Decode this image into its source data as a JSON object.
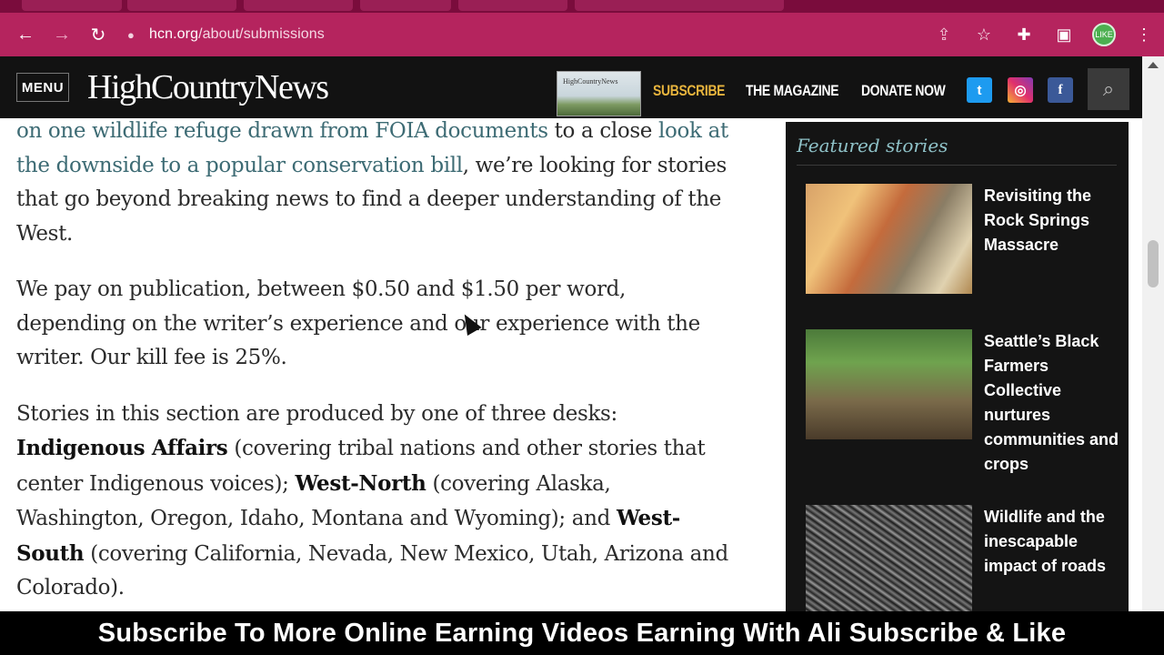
{
  "browser": {
    "url_host": "hcn.org",
    "url_path": "/about/submissions",
    "profile_label": "LIKE",
    "colors": {
      "frame": "#b5245e",
      "tabstrip": "#7a0c3c"
    }
  },
  "site": {
    "menu_label": "MENU",
    "logo_text": "HighCountryNews",
    "magazine_thumb_label": "HighCountryNews",
    "nav": {
      "subscribe": "SUBSCRIBE",
      "magazine": "THE MAGAZINE",
      "donate": "DONATE NOW"
    },
    "social": {
      "twitter": "t",
      "instagram": "◎",
      "facebook": "f"
    },
    "accent_color": "#e8b43d"
  },
  "article": {
    "p1": {
      "link1": "on one wildlife refuge drawn from FOIA documents",
      "text1": " to a close ",
      "link2": "look at the downside to a popular conservation bill",
      "text2": ", we’re looking for stories that go beyond breaking news to find a deeper understanding of the West."
    },
    "p2": "We pay on publication, between $0.50 and $1.50 per word, depending on the writer’s experience and our experience with the writer. Our kill fee is 25%.",
    "p3": {
      "intro": "Stories in this section are produced by one of three desks: ",
      "desk1": "Indigenous Affairs",
      "desk1_desc": " (covering tribal nations and other stories that center Indigenous voices); ",
      "desk2": "West-North",
      "desk2_desc": " (covering Alaska, Washington, Oregon, Idaho, Montana and Wyoming); and ",
      "desk3": "West-South",
      "desk3_desc": " (covering California, Nevada, New Mexico, Utah, Arizona and Colorado)."
    }
  },
  "sidebar": {
    "title": "Featured stories",
    "stories": [
      {
        "headline": "Revisiting the Rock Springs Massacre"
      },
      {
        "headline": "Seattle’s Black Farmers Collective nurtures communities and crops"
      },
      {
        "headline": "Wildlife and the inescapable impact of roads"
      }
    ]
  },
  "banner": {
    "text": "Subscribe To More Online Earning Videos Earning With Ali Subscribe & Like"
  }
}
